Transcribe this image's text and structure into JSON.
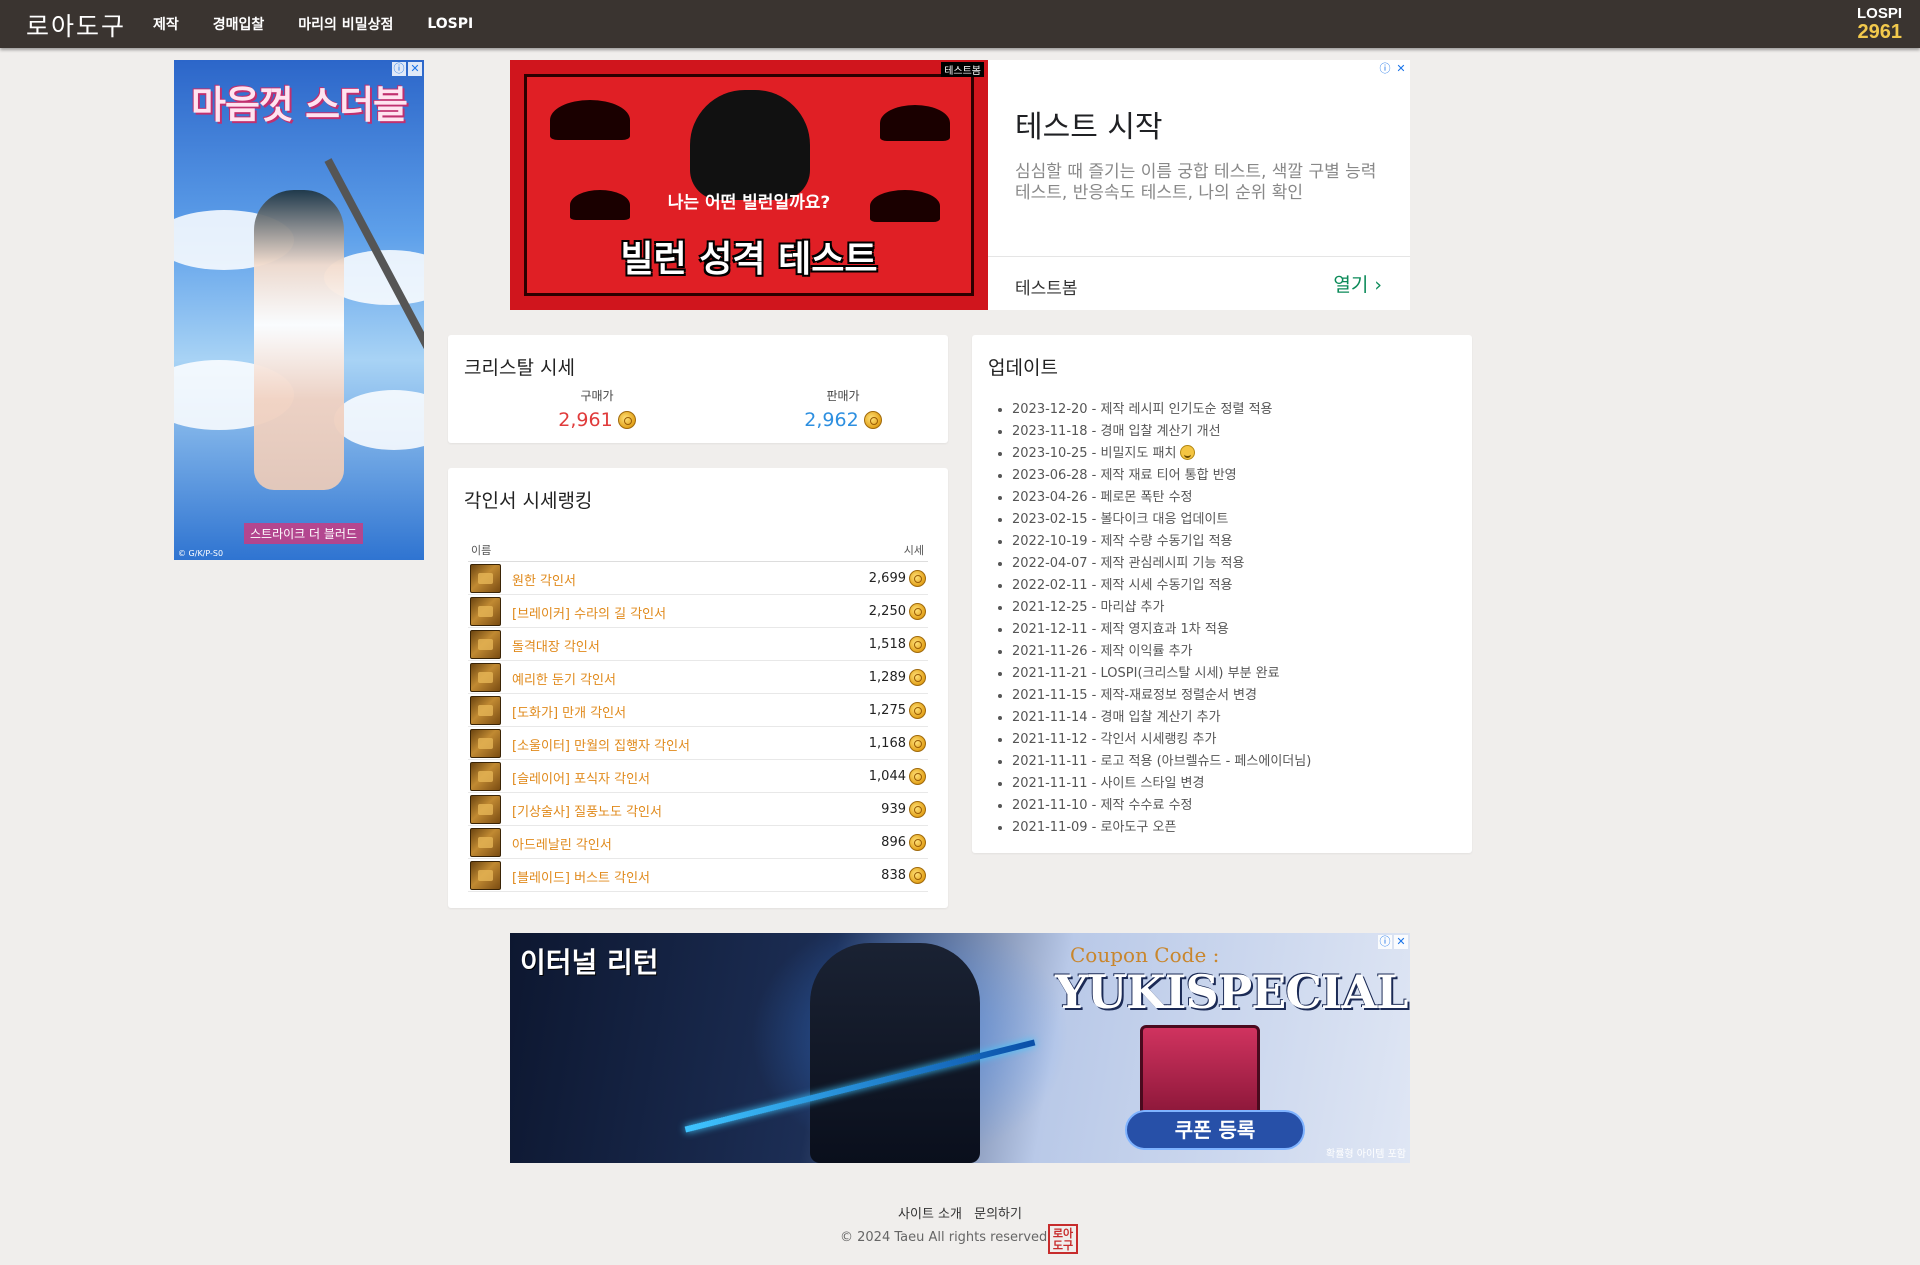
{
  "header": {
    "logo": "로아도구",
    "nav": [
      "제작",
      "경매입찰",
      "마리의 비밀상점",
      "LOSPI"
    ],
    "lospi_label": "LOSPI",
    "lospi_value": "2961"
  },
  "side_ad": {
    "title": "마음껏 스더블",
    "sublogo": "스트라이크 더 블러드",
    "copyright": "© G/K/P-S0"
  },
  "top_ad": {
    "brand": "테스트봄",
    "image_question": "나는 어떤 빌런일까요?",
    "image_title": "빌런 성격 테스트",
    "headline": "테스트 시작",
    "description": "심심할 때 즐기는 이름 궁합 테스트, 색깔 구별 능력 테스트, 반응속도 테스트, 나의 순위 확인",
    "advertiser": "테스트봄",
    "open_label": "열기 ›"
  },
  "crystal": {
    "title": "크리스탈 시세",
    "buy_label": "구매가",
    "buy_value": "2,961",
    "sell_label": "판매가",
    "sell_value": "2,962",
    "colors": {
      "buy": "#e03b3b",
      "sell": "#2d8fe0"
    }
  },
  "ranking": {
    "title": "각인서 시세랭킹",
    "col_name": "이름",
    "col_price": "시세",
    "rows": [
      {
        "name": "원한 각인서",
        "value": "2,699"
      },
      {
        "name": "[브레이커] 수라의 길 각인서",
        "value": "2,250"
      },
      {
        "name": "돌격대장 각인서",
        "value": "1,518"
      },
      {
        "name": "예리한 둔기 각인서",
        "value": "1,289"
      },
      {
        "name": "[도화가] 만개 각인서",
        "value": "1,275"
      },
      {
        "name": "[소울이터] 만월의 집행자 각인서",
        "value": "1,168"
      },
      {
        "name": "[슬레이어] 포식자 각인서",
        "value": "1,044"
      },
      {
        "name": "[기상술사] 질풍노도 각인서",
        "value": "939"
      },
      {
        "name": "아드레날린 각인서",
        "value": "896"
      },
      {
        "name": "[블레이드] 버스트 각인서",
        "value": "838"
      }
    ]
  },
  "updates": {
    "title": "업데이트",
    "items": [
      "2023-12-20 - 제작 레시피 인기도순 정렬 적용",
      "2023-11-18 - 경매 입찰 계산기 개선",
      "2023-10-25 - 비밀지도 패치",
      "2023-06-28 - 제작 재료 티어 통합 반영",
      "2023-04-26 - 페로몬 폭탄 수정",
      "2023-02-15 - 볼다이크 대응 업데이트",
      "2022-10-19 - 제작 수량 수동기입 적용",
      "2022-04-07 - 제작 관심레시피 기능 적용",
      "2022-02-11 - 제작 시세 수동기입 적용",
      "2021-12-25 - 마리샵 추가",
      "2021-12-11 - 제작 영지효과 1차 적용",
      "2021-11-26 - 제작 이익률 추가",
      "2021-11-21 - LOSPI(크리스탈 시세) 부분 완료",
      "2021-11-15 - 제작-재료정보 정렬순서 변경",
      "2021-11-14 - 경매 입찰 계산기 추가",
      "2021-11-12 - 각인서 시세랭킹 추가",
      "2021-11-11 - 로고 적용 (아브렐슈드 - 페스에이더님)",
      "2021-11-11 - 사이트 스타일 변경",
      "2021-11-10 - 제작 수수료 수정",
      "2021-11-09 - 로아도구 오픈"
    ]
  },
  "bottom_ad": {
    "game": "이터널 리턴",
    "coupon_label": "Coupon Code :",
    "coupon_code": "YUKISPECIAL",
    "button": "쿠폰 등록",
    "fine": "확률형 아이템 포함"
  },
  "footer": {
    "about": "사이트 소개",
    "contact": "문의하기",
    "copyright": "© 2024 Taeu All rights reserved",
    "stamp": "로아도구"
  }
}
